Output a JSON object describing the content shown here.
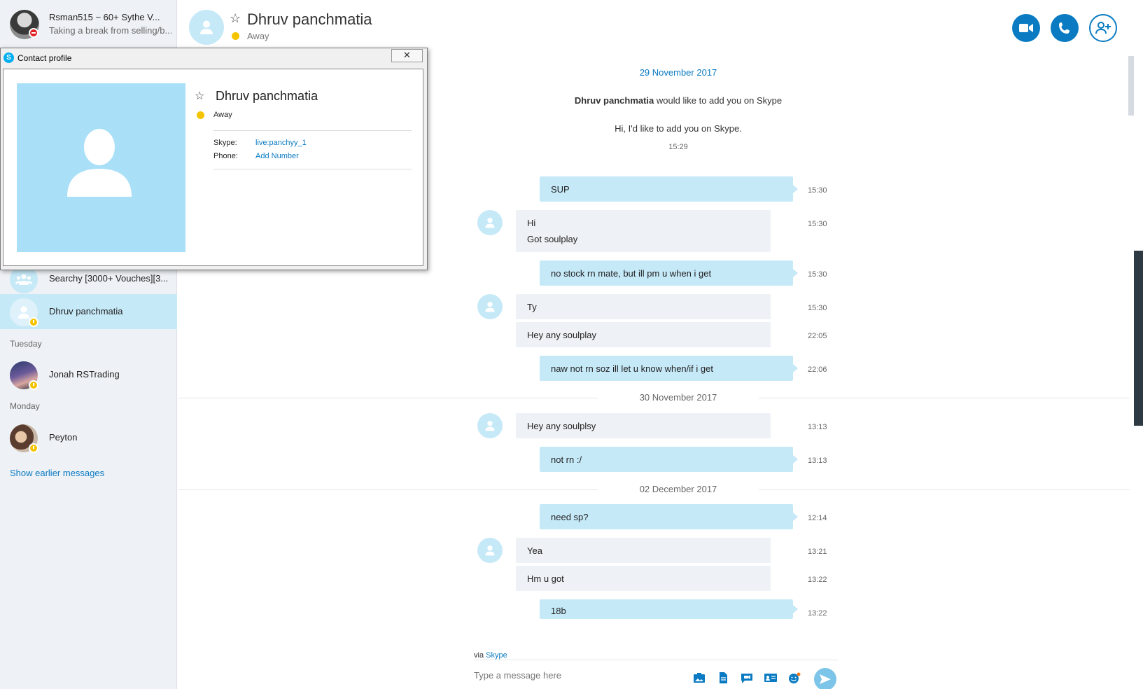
{
  "me": {
    "name": "Rsman515 ~ 60+ Sythe V...",
    "mood": "Taking a break from selling/b..."
  },
  "sidebar": {
    "conversations": [
      {
        "name": "Searchy [3000+ Vouches][3..."
      },
      {
        "name": "Dhruv panchmatia"
      }
    ],
    "sections": [
      {
        "label": "Tuesday",
        "name": "Jonah RSTrading"
      },
      {
        "label": "Monday",
        "name": "Peyton"
      }
    ],
    "show_earlier": "Show earlier messages"
  },
  "header": {
    "contact_name": "Dhruv panchmatia",
    "status": "Away"
  },
  "profile_window": {
    "title": "Contact profile",
    "name": "Dhruv panchmatia",
    "status": "Away",
    "skype_label": "Skype:",
    "skype_value": "live:panchyy_1",
    "phone_label": "Phone:",
    "phone_value": "Add Number"
  },
  "chat": {
    "dates": [
      "29 November 2017",
      "30 November 2017",
      "02 December 2017"
    ],
    "request_name": "Dhruv panchmatia",
    "request_text": " would like to add you on Skype",
    "request_message": "Hi, I'd like to add you on Skype.",
    "request_time": "15:29",
    "messages": [
      {
        "dir": "out",
        "text": "SUP",
        "time": "15:30"
      },
      {
        "dir": "in",
        "text": "Hi",
        "text2": "Got soulplay",
        "time": "15:30"
      },
      {
        "dir": "out",
        "text": "no stock rn mate, but ill pm u when i get",
        "time": "15:30"
      },
      {
        "dir": "in",
        "text": "Ty",
        "time": "15:30"
      },
      {
        "dir": "in",
        "text": "Hey any soulplay",
        "time": "22:05"
      },
      {
        "dir": "out",
        "text": "naw not rn soz ill let u know when/if i get",
        "time": "22:06"
      },
      {
        "dir": "in",
        "text": "Hey any soulplsy",
        "time": "13:13"
      },
      {
        "dir": "out",
        "text": "not rn :/",
        "time": "13:13"
      },
      {
        "dir": "out",
        "text": "need sp?",
        "time": "12:14"
      },
      {
        "dir": "in",
        "text": " Yea",
        "time": "13:21"
      },
      {
        "dir": "in",
        "text": "Hm u got",
        "time": "13:22"
      },
      {
        "dir": "out",
        "text": "18b",
        "time": "13:22"
      }
    ]
  },
  "composer": {
    "via_prefix": "via ",
    "via_link": "Skype",
    "placeholder": "Type a message here"
  },
  "colors": {
    "accent": "#0a7bc2",
    "bubble_out": "#c6e9f8",
    "bubble_in": "#eef1f5",
    "away": "#f5c400",
    "dnd": "#e02020"
  }
}
